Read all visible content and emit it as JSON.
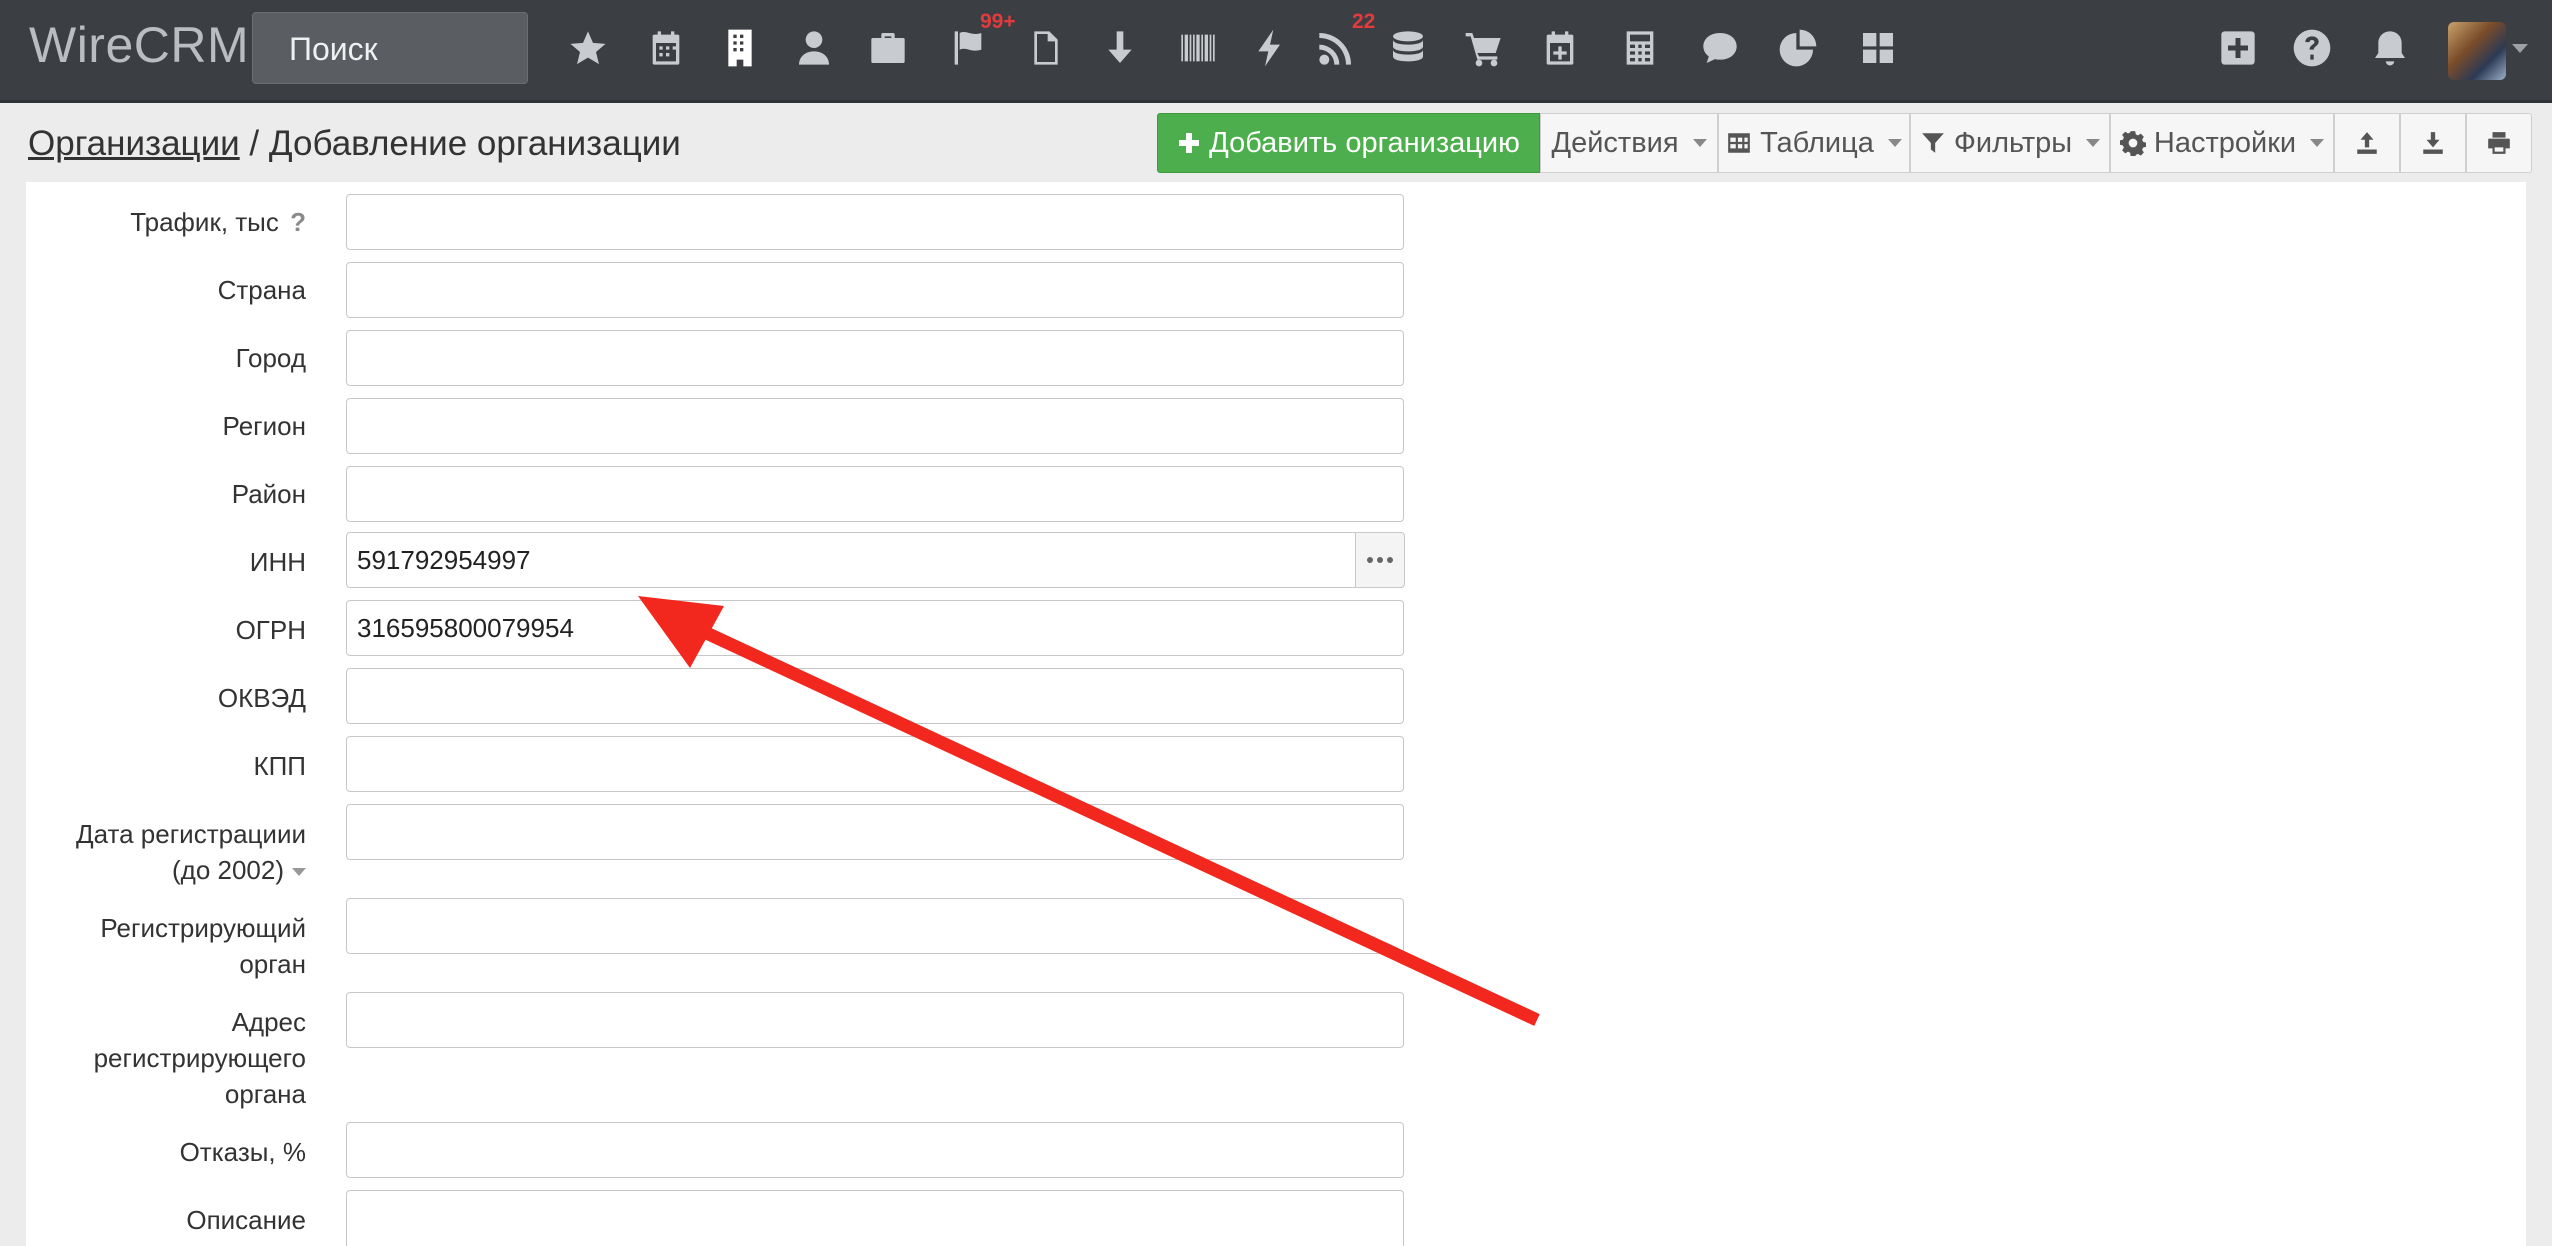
{
  "app": {
    "logo": "WireCRM",
    "search_placeholder": "Поиск",
    "nav_icons": [
      "star-icon",
      "calendar-icon",
      "building-icon",
      "user-icon",
      "briefcase-icon",
      "flag-icon",
      "document-icon",
      "download-arrow-icon",
      "barcode-icon",
      "bolt-icon",
      "rss-icon",
      "database-icon",
      "cart-icon",
      "calendar-plus-icon",
      "calculator-icon",
      "chat-icon",
      "pie-chart-icon",
      "grid-icon"
    ],
    "badges": {
      "flag": "99+",
      "rss": "22"
    },
    "right_icons": [
      "plus-square-icon",
      "question-icon",
      "bell-icon"
    ]
  },
  "page": {
    "breadcrumb_link": "Организации",
    "breadcrumb_sep": " / ",
    "title": "Добавление организации"
  },
  "toolbar": {
    "add_label": "Добавить организацию",
    "actions_label": "Действия",
    "table_label": "Таблица",
    "filters_label": "Фильтры",
    "settings_label": "Настройки"
  },
  "form": {
    "traffic_label": "Трафик, тыс",
    "traffic_help": "?",
    "country_label": "Страна",
    "city_label": "Город",
    "region_label": "Регион",
    "district_label": "Район",
    "inn_label": "ИНН",
    "inn_value": "591792954997",
    "ogrn_label": "ОГРН",
    "ogrn_value": "316595800079954",
    "okved_label": "ОКВЭД",
    "kpp_label": "КПП",
    "regdate_label_1": "Дата регистрациии",
    "regdate_label_2": "(до 2002)",
    "regorg_label_1": "Регистрирующий",
    "regorg_label_2": "орган",
    "regaddr_label_1": "Адрес",
    "regaddr_label_2": "регистрирующего",
    "regaddr_label_3": "органа",
    "refusals_label": "Отказы, %",
    "description_label": "Описание"
  },
  "colors": {
    "accent_green": "#4cae4c",
    "arrow_red": "#f2271d",
    "navbar": "#3b3e43"
  }
}
